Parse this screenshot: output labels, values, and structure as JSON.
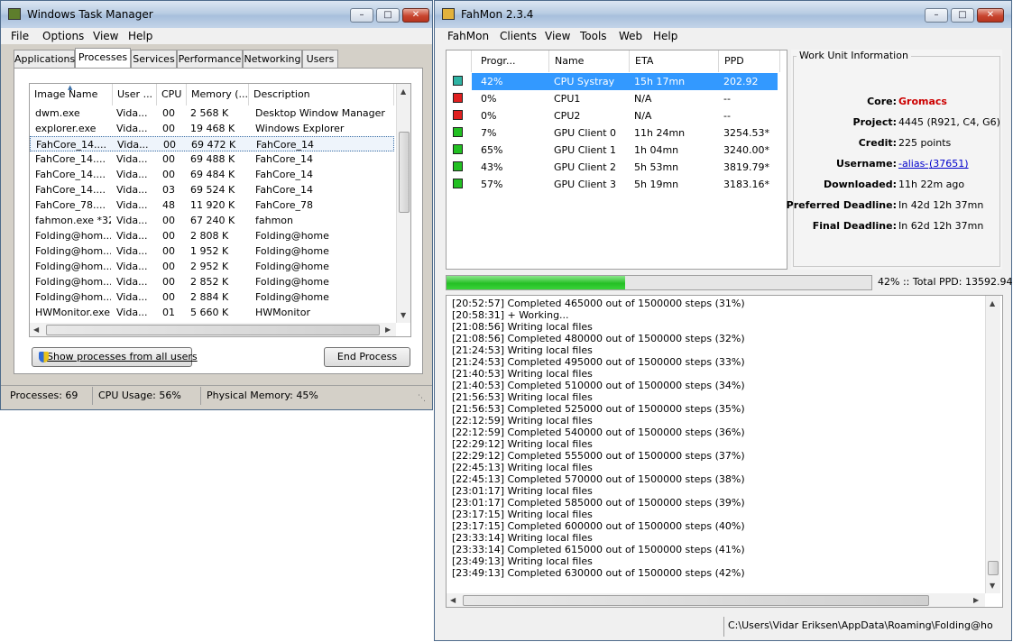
{
  "taskmgr": {
    "title": "Windows Task Manager",
    "menu": [
      "File",
      "Options",
      "View",
      "Help"
    ],
    "tabs": [
      "Applications",
      "Processes",
      "Services",
      "Performance",
      "Networking",
      "Users"
    ],
    "columns": [
      "Image Name",
      "User ...",
      "CPU",
      "Memory (...",
      "Description"
    ],
    "rows": [
      [
        "dwm.exe",
        "Vida...",
        "00",
        "2 568 K",
        "Desktop Window Manager"
      ],
      [
        "explorer.exe",
        "Vida...",
        "00",
        "19 468 K",
        "Windows Explorer"
      ],
      [
        "FahCore_14....",
        "Vida...",
        "00",
        "69 472 K",
        "FahCore_14"
      ],
      [
        "FahCore_14....",
        "Vida...",
        "00",
        "69 488 K",
        "FahCore_14"
      ],
      [
        "FahCore_14....",
        "Vida...",
        "00",
        "69 484 K",
        "FahCore_14"
      ],
      [
        "FahCore_14....",
        "Vida...",
        "03",
        "69 524 K",
        "FahCore_14"
      ],
      [
        "FahCore_78....",
        "Vida...",
        "48",
        "11 920 K",
        "FahCore_78"
      ],
      [
        "fahmon.exe *32",
        "Vida...",
        "00",
        "67 240 K",
        "fahmon"
      ],
      [
        "Folding@hom...",
        "Vida...",
        "00",
        "2 808 K",
        "Folding@home"
      ],
      [
        "Folding@hom...",
        "Vida...",
        "00",
        "1 952 K",
        "Folding@home"
      ],
      [
        "Folding@hom...",
        "Vida...",
        "00",
        "2 952 K",
        "Folding@home"
      ],
      [
        "Folding@hom...",
        "Vida...",
        "00",
        "2 852 K",
        "Folding@home"
      ],
      [
        "Folding@hom...",
        "Vida...",
        "00",
        "2 884 K",
        "Folding@home"
      ],
      [
        "HWMonitor.exe",
        "Vida...",
        "01",
        "5 660 K",
        "HWMonitor"
      ]
    ],
    "show_all_label": "Show processes from all users",
    "end_process_label": "End Process",
    "status": {
      "processes": "Processes: 69",
      "cpu": "CPU Usage: 56%",
      "memory": "Physical Memory: 45%"
    }
  },
  "fahmon": {
    "title": "FahMon 2.3.4",
    "menu": [
      "FahMon",
      "Clients",
      "View",
      "Tools",
      "Web",
      "Help"
    ],
    "columns": [
      "Progr...",
      "Name",
      "ETA",
      "PPD"
    ],
    "clients": [
      {
        "progress": "42%",
        "name": "CPU Systray",
        "eta": "15h 17mn",
        "ppd": "202.92",
        "color": "#2fb3a3"
      },
      {
        "progress": "0%",
        "name": "CPU1",
        "eta": "N/A",
        "ppd": "--",
        "color": "#e02020"
      },
      {
        "progress": "0%",
        "name": "CPU2",
        "eta": "N/A",
        "ppd": "--",
        "color": "#e02020"
      },
      {
        "progress": "7%",
        "name": "GPU Client 0",
        "eta": "11h 24mn",
        "ppd": "3254.53*",
        "color": "#22c022"
      },
      {
        "progress": "65%",
        "name": "GPU Client 1",
        "eta": "1h 04mn",
        "ppd": "3240.00*",
        "color": "#22c022"
      },
      {
        "progress": "43%",
        "name": "GPU Client 2",
        "eta": "5h 53mn",
        "ppd": "3819.79*",
        "color": "#22c022"
      },
      {
        "progress": "57%",
        "name": "GPU Client 3",
        "eta": "5h 19mn",
        "ppd": "3183.16*",
        "color": "#22c022"
      }
    ],
    "work_unit": {
      "heading": "Work Unit Information",
      "rows": [
        {
          "label": "Core:",
          "value": "Gromacs"
        },
        {
          "label": "Project:",
          "value": "4445 (R921, C4, G6)"
        },
        {
          "label": "Credit:",
          "value": "225 points"
        },
        {
          "label": "Username:",
          "value": "-alias-",
          "value2": "(37651)"
        },
        {
          "label": "Downloaded:",
          "value": "11h 22m ago"
        },
        {
          "label": "Preferred Deadline:",
          "value": "In 42d 12h 37mn"
        },
        {
          "label": "Final Deadline:",
          "value": "In 62d 12h 37mn"
        }
      ]
    },
    "progress_fraction": 0.42,
    "progress_text": "42% :: Total PPD: 13592.94",
    "log": [
      "[20:52:57] Completed 465000 out of 1500000 steps  (31%)",
      "[20:58:31] + Working...",
      "[21:08:56] Writing local files",
      "[21:08:56] Completed 480000 out of 1500000 steps  (32%)",
      "[21:24:53] Writing local files",
      "[21:24:53] Completed 495000 out of 1500000 steps  (33%)",
      "[21:40:53] Writing local files",
      "[21:40:53] Completed 510000 out of 1500000 steps  (34%)",
      "[21:56:53] Writing local files",
      "[21:56:53] Completed 525000 out of 1500000 steps  (35%)",
      "[22:12:59] Writing local files",
      "[22:12:59] Completed 540000 out of 1500000 steps  (36%)",
      "[22:29:12] Writing local files",
      "[22:29:12] Completed 555000 out of 1500000 steps  (37%)",
      "[22:45:13] Writing local files",
      "[22:45:13] Completed 570000 out of 1500000 steps  (38%)",
      "[23:01:17] Writing local files",
      "[23:01:17] Completed 585000 out of 1500000 steps  (39%)",
      "[23:17:15] Writing local files",
      "[23:17:15] Completed 600000 out of 1500000 steps  (40%)",
      "[23:33:14] Writing local files",
      "[23:33:14] Completed 615000 out of 1500000 steps  (41%)",
      "[23:49:13] Writing local files",
      "[23:49:13] Completed 630000 out of 1500000 steps  (42%)"
    ],
    "status_path": "C:\\Users\\Vidar Eriksen\\AppData\\Roaming\\Folding@ho"
  }
}
